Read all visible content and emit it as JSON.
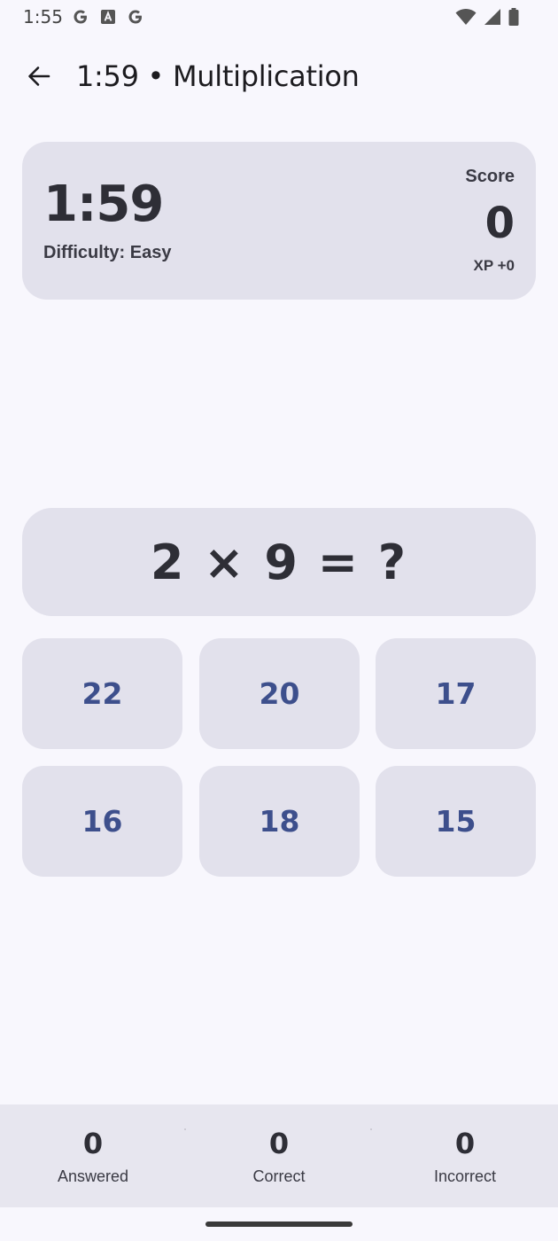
{
  "status_bar": {
    "time": "1:55",
    "left_icons": [
      "google-g-icon",
      "news-a-icon",
      "google-g-icon"
    ],
    "right_icons": [
      "wifi-icon",
      "cell-signal-icon",
      "battery-icon"
    ]
  },
  "app_bar": {
    "title": "1:59 • Multiplication"
  },
  "header": {
    "timer": "1:59",
    "difficulty": "Difficulty: Easy",
    "score_label": "Score",
    "score_value": "0",
    "xp": "XP +0"
  },
  "question": {
    "text": "2 × 9 = ?"
  },
  "answers": [
    "22",
    "20",
    "17",
    "16",
    "18",
    "15"
  ],
  "stats": [
    {
      "value": "0",
      "label": "Answered"
    },
    {
      "value": "0",
      "label": "Correct"
    },
    {
      "value": "0",
      "label": "Incorrect"
    }
  ],
  "colors": {
    "background": "#f8f7fd",
    "card": "#e2e1ec",
    "answer_text": "#3d4f8c",
    "primary_text": "#2e2e36"
  }
}
